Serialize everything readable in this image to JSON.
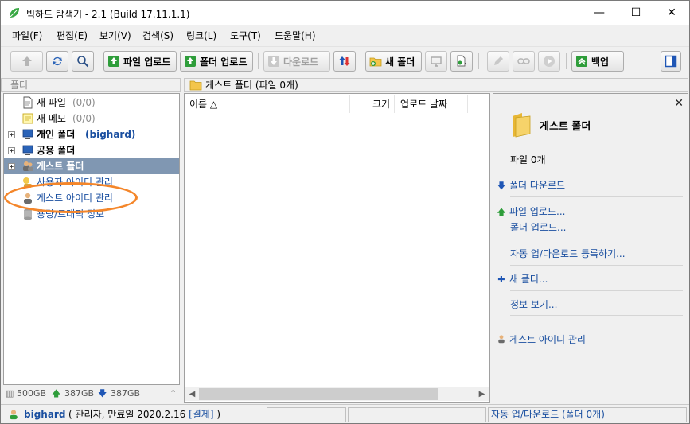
{
  "window": {
    "title": "빅하드 탐색기 - 2.1 (Build 17.11.1.1)",
    "minimize": "—",
    "maximize": "☐",
    "close": "✕"
  },
  "menu": [
    "파일(F)",
    "편집(E)",
    "보기(V)",
    "검색(S)",
    "링크(L)",
    "도구(T)",
    "도움말(H)"
  ],
  "toolbar": {
    "upload_file": "파일 업로드",
    "upload_folder": "폴더 업로드",
    "download": "다운로드",
    "new_folder": "새 폴더",
    "backup": "백업"
  },
  "left_pane": {
    "header": "폴더",
    "items": [
      {
        "label": "새 파일",
        "count": "(0/0)"
      },
      {
        "label": "새 메모",
        "count": "(0/0)"
      },
      {
        "label": "개인 폴더",
        "owner": "(bighard)"
      },
      {
        "label": "공용 폴더"
      },
      {
        "label": "게스트 폴더"
      },
      {
        "label": "사용자 아이디 관리"
      },
      {
        "label": "게스트 아이디 관리"
      },
      {
        "label": "용량/트래픽 정보"
      }
    ],
    "status": {
      "total": "500GB",
      "upload": "387GB",
      "download": "387GB"
    }
  },
  "file_list": {
    "path": "게스트 폴더 (파일 0개)",
    "columns": [
      "이름 △",
      "크기",
      "업로드 날짜"
    ]
  },
  "info_pane": {
    "title": "게스트 폴더",
    "file_count": "파일 0개",
    "links": {
      "folder_download": "폴더 다운로드",
      "file_upload": "파일 업로드...",
      "folder_upload": "폴더 업로드...",
      "auto_register": "자동 업/다운로드 등록하기...",
      "new_folder": "새 폴더...",
      "info_view": "정보 보기...",
      "guest_id": "게스트 아이디 관리"
    }
  },
  "statusbar": {
    "user": "bighard",
    "detail_prefix": "( 관리자, 만료일 2020.2.16 ",
    "payment": "[결제]",
    "detail_suffix": " )",
    "auto": "자동 업/다운로드 (폴더 0개)"
  },
  "colors": {
    "selection": "#8097b2",
    "link": "#1a4fa0",
    "annotation": "#f4862a",
    "upload_arrow": "#2e9d3a",
    "download_arrow": "#1f56b5"
  }
}
